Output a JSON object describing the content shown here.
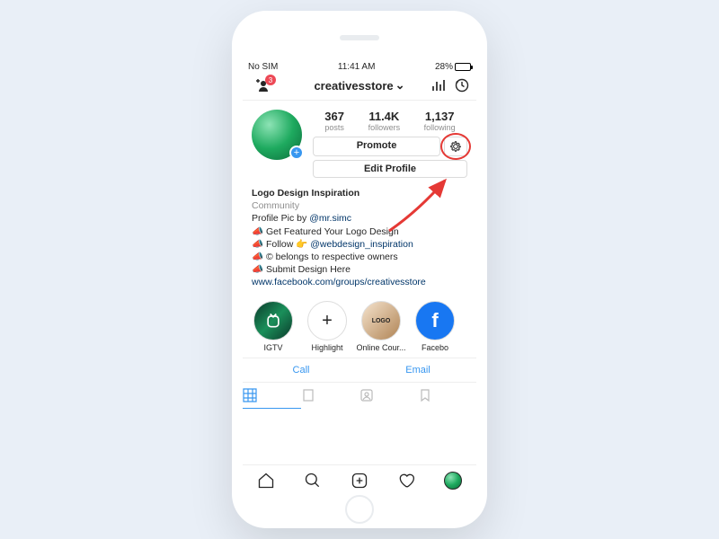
{
  "status": {
    "carrier": "No SIM",
    "time": "11:41 AM",
    "battery_pct": "28%"
  },
  "nav": {
    "notif_count": "3",
    "username": "creativesstore"
  },
  "stats": {
    "posts_n": "367",
    "posts_l": "posts",
    "followers_n": "11.4K",
    "followers_l": "followers",
    "following_n": "1,137",
    "following_l": "following"
  },
  "buttons": {
    "promote": "Promote",
    "edit": "Edit Profile"
  },
  "bio": {
    "name": "Logo Design Inspiration",
    "category": "Community",
    "line_pic_pre": "Profile Pic by ",
    "line_pic_link": "@mr.simc",
    "line1": " Get Featured Your Logo Design",
    "line2a": " Follow 👉 ",
    "line2b": "@webdesign_inspiration",
    "line3": " © belongs to respective owners",
    "line4": " Submit Design Here",
    "url": "www.facebook.com/groups/creativesstore"
  },
  "highlights": {
    "igtv": "IGTV",
    "add": "Highlight",
    "course": "Online Cour...",
    "fb": "Facebo"
  },
  "contact": {
    "call": "Call",
    "email": "Email"
  }
}
